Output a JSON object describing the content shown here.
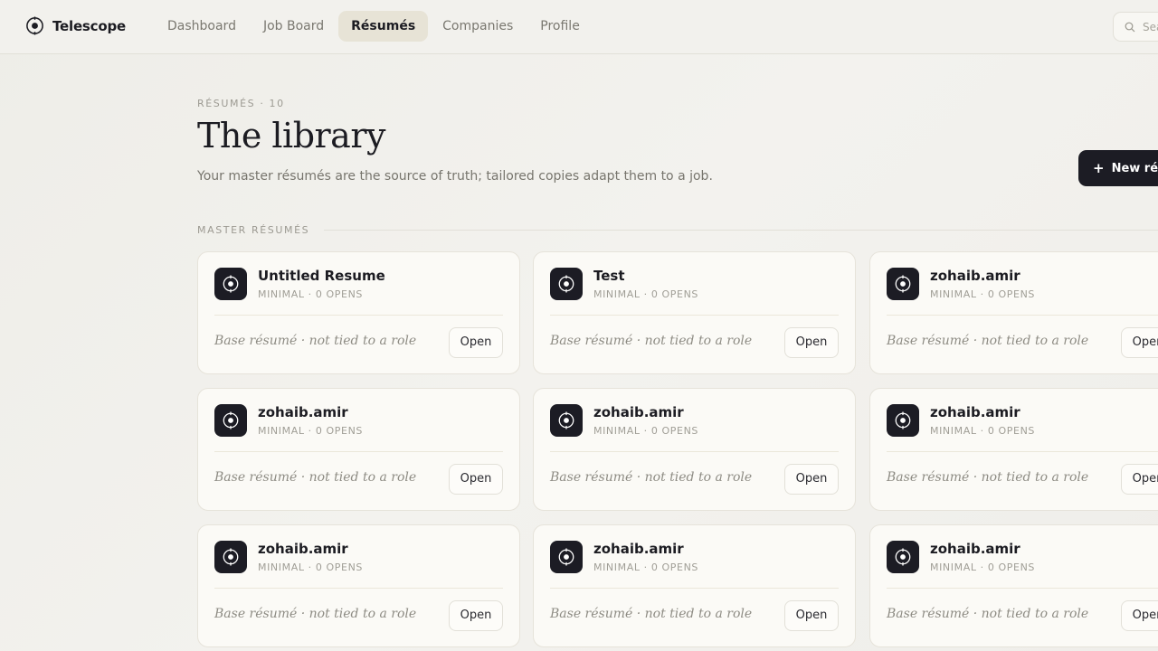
{
  "app": {
    "name": "Telescope"
  },
  "nav": [
    {
      "label": "Dashboard",
      "active": false
    },
    {
      "label": "Job Board",
      "active": false
    },
    {
      "label": "Résumés",
      "active": true
    },
    {
      "label": "Companies",
      "active": false
    },
    {
      "label": "Profile",
      "active": false
    }
  ],
  "search": {
    "placeholder": "Search"
  },
  "header": {
    "eyebrow": "RÉSUMÉS · 10",
    "title": "The library",
    "subtitle": "Your master résumés are the source of truth; tailored copies adapt them to a job.",
    "new_button_label": "New résumé",
    "new_button_icon": "+"
  },
  "section": {
    "label": "MASTER RÉSUMÉS"
  },
  "cards": [
    {
      "title": "Untitled Resume",
      "meta": "MINIMAL · 0 OPENS",
      "note": "Base résumé · not tied to a role",
      "open_label": "Open"
    },
    {
      "title": "Test",
      "meta": "MINIMAL · 0 OPENS",
      "note": "Base résumé · not tied to a role",
      "open_label": "Open"
    },
    {
      "title": "zohaib.amir",
      "meta": "MINIMAL · 0 OPENS",
      "note": "Base résumé · not tied to a role",
      "open_label": "Open"
    },
    {
      "title": "zohaib.amir",
      "meta": "MINIMAL · 0 OPENS",
      "note": "Base résumé · not tied to a role",
      "open_label": "Open"
    },
    {
      "title": "zohaib.amir",
      "meta": "MINIMAL · 0 OPENS",
      "note": "Base résumé · not tied to a role",
      "open_label": "Open"
    },
    {
      "title": "zohaib.amir",
      "meta": "MINIMAL · 0 OPENS",
      "note": "Base résumé · not tied to a role",
      "open_label": "Open"
    },
    {
      "title": "zohaib.amir",
      "meta": "MINIMAL · 0 OPENS",
      "note": "Base résumé · not tied to a role",
      "open_label": "Open"
    },
    {
      "title": "zohaib.amir",
      "meta": "MINIMAL · 0 OPENS",
      "note": "Base résumé · not tied to a role",
      "open_label": "Open"
    },
    {
      "title": "zohaib.amir",
      "meta": "MINIMAL · 0 OPENS",
      "note": "Base résumé · not tied to a role",
      "open_label": "Open"
    }
  ],
  "icons": {
    "brand": "telescope-logo-icon",
    "card": "telescope-logo-icon",
    "search": "search-icon"
  },
  "colors": {
    "accent_dark": "#1c1c24",
    "nav_active_bg": "#e7e3d6",
    "page_bg": "#efeeea"
  }
}
